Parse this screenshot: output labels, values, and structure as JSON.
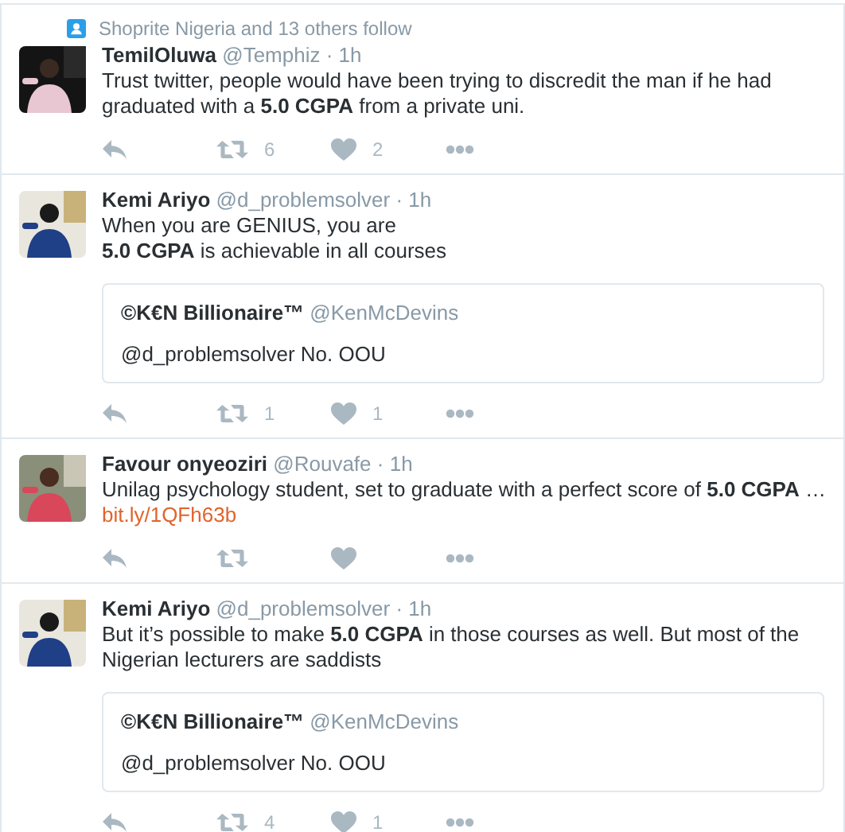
{
  "tweets": [
    {
      "context": "Shoprite Nigeria and 13 others follow",
      "name": "TemilOluwa",
      "handle": "@Temphiz",
      "time": "· 1h",
      "text": "Trust twitter, people would have been trying to discredit the man if he had graduated with a **5.0 CGPA** from a private uni.",
      "retweets": "6",
      "likes": "2"
    },
    {
      "name": "Kemi Ariyo",
      "handle": "@d_problemsolver",
      "time": "· 1h",
      "text": "When you are GENIUS, you are\n**5.0 CGPA** is achievable in all courses",
      "quote": {
        "name": "©K€N Billionaire™",
        "handle": "@KenMcDevins",
        "text": "@d_problemsolver No. OOU"
      },
      "retweets": "1",
      "likes": "1"
    },
    {
      "name": "Favour onyeoziri",
      "handle": "@Rouvafe",
      "time": "· 1h",
      "text": "Unilag psychology student, set to graduate with a perfect score of **5.0 CGPA** …",
      "link": "bit.ly/1QFh63b"
    },
    {
      "name": "Kemi Ariyo",
      "handle": "@d_problemsolver",
      "time": "· 1h",
      "text": "But it’s possible to make **5.0 CGPA** in those courses as well. But most of the Nigerian lecturers are saddists",
      "quote": {
        "name": "©K€N Billionaire™",
        "handle": "@KenMcDevins",
        "text": "@d_problemsolver No. OOU"
      },
      "retweets": "4",
      "likes": "1"
    }
  ]
}
